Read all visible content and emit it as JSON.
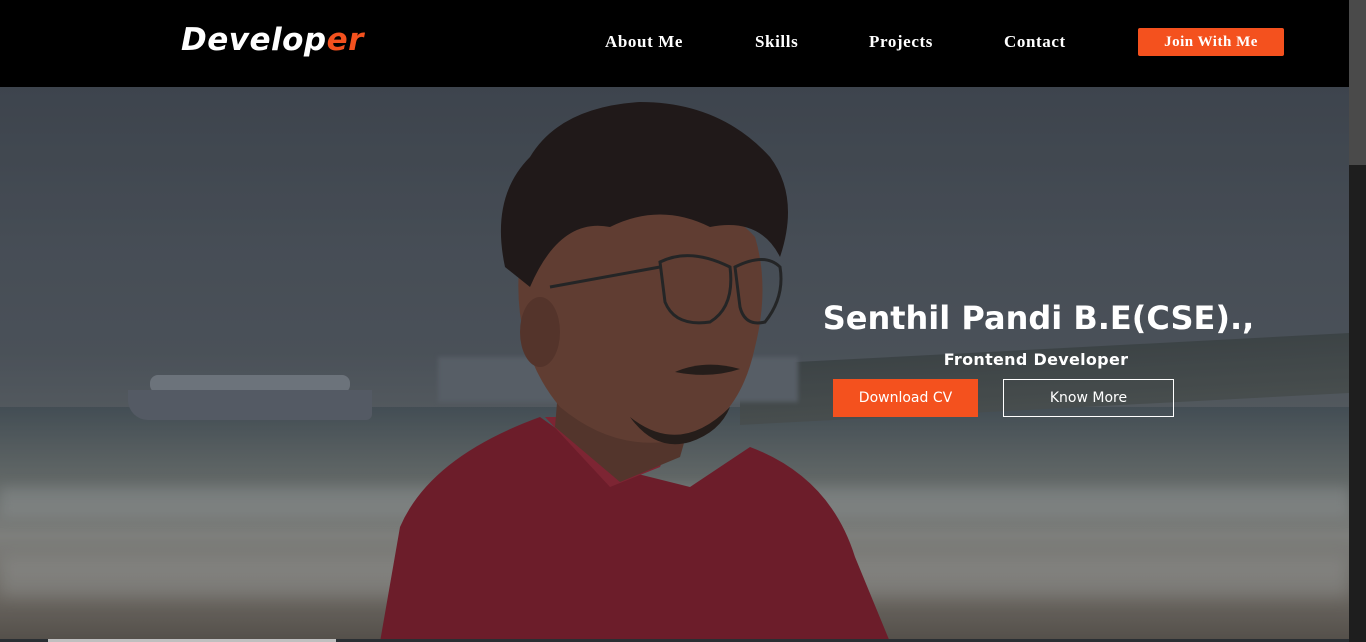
{
  "brand": {
    "text_main": "Develop",
    "text_accent": "er"
  },
  "nav": {
    "links": [
      "About Me",
      "Skills",
      "Projects",
      "Contact"
    ],
    "cta": "Join With Me"
  },
  "hero": {
    "name": "Senthil Pandi B.E(CSE).,",
    "role": "Frontend Developer",
    "primary_button": "Download CV",
    "secondary_button": "Know More"
  },
  "colors": {
    "accent": "#f4511e",
    "navbar": "#000000",
    "shirt": "#9c2235"
  }
}
